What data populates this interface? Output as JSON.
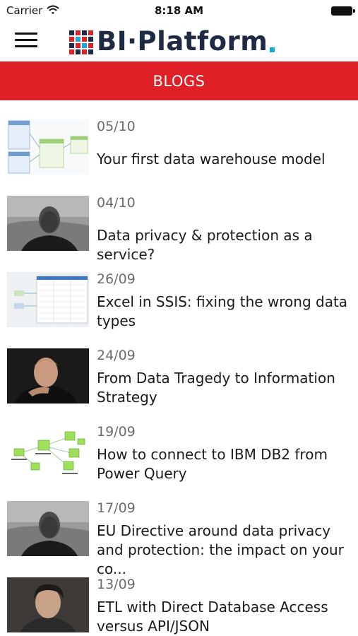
{
  "status_bar": {
    "carrier": "Carrier",
    "time": "8:18 AM",
    "wifi_icon": "wifi-icon",
    "battery_icon": "battery-icon"
  },
  "header": {
    "menu_icon": "hamburger-menu-icon",
    "logo_text": "BI·Platform",
    "colors": {
      "logo_text": "#1f2a44",
      "logo_dot": "#1aa6d9"
    }
  },
  "section": {
    "title": "BLOGS",
    "background": "#e02027"
  },
  "posts": [
    {
      "date": "05/10",
      "title": "Your first data warehouse model",
      "thumbnail": "diagram-thumbnail"
    },
    {
      "date": "04/10",
      "title": "Data privacy & protection as a service?",
      "thumbnail": "portrait-thumbnail"
    },
    {
      "date": "26/09",
      "title": "Excel in SSIS: fixing the wrong data types",
      "thumbnail": "screenshot-thumbnail"
    },
    {
      "date": "24/09",
      "title": "From Data Tragedy to Information Strategy",
      "thumbnail": "portrait-thumbnail"
    },
    {
      "date": "19/09",
      "title": "How to connect to IBM DB2 from Power Query",
      "thumbnail": "diagram-thumbnail"
    },
    {
      "date": "17/09",
      "title": "EU Directive around data privacy and protection: the impact on your co...",
      "thumbnail": "portrait-thumbnail"
    },
    {
      "date": "13/09",
      "title": "ETL with Direct Database Access versus API/JSON",
      "thumbnail": "portrait-thumbnail"
    }
  ]
}
